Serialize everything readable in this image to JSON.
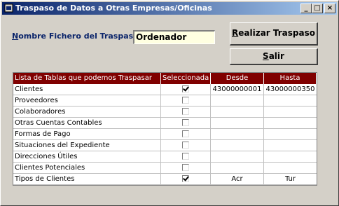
{
  "window": {
    "title": "Traspaso de Datos a Otras Empresas/Oficinas",
    "minimize": "_",
    "maximize": "□",
    "close": "×"
  },
  "form": {
    "fichero_label_first": "N",
    "fichero_label_rest": "ombre Fichero del Traspaso",
    "fichero_value": "Ordenador"
  },
  "buttons": {
    "realizar_first": "R",
    "realizar_rest": "ealizar Traspaso",
    "salir_first": "S",
    "salir_rest": "alir"
  },
  "table": {
    "headers": [
      "Lista de Tablas que podemos Traspasar",
      "Seleccionada",
      "Desde",
      "Hasta"
    ],
    "rows": [
      {
        "name": "Clientes",
        "checked": true,
        "desde": "43000000001",
        "hasta": "43000000350"
      },
      {
        "name": "Proveedores",
        "checked": false,
        "desde": "",
        "hasta": ""
      },
      {
        "name": "Colaboradores",
        "checked": false,
        "desde": "",
        "hasta": ""
      },
      {
        "name": "Otras Cuentas Contables",
        "checked": false,
        "desde": "",
        "hasta": ""
      },
      {
        "name": "Formas de Pago",
        "checked": false,
        "desde": "",
        "hasta": ""
      },
      {
        "name": "Situaciones del Expediente",
        "checked": false,
        "desde": "",
        "hasta": ""
      },
      {
        "name": "Direcciones Útiles",
        "checked": false,
        "desde": "",
        "hasta": ""
      },
      {
        "name": "Clientes Potenciales",
        "checked": false,
        "desde": "",
        "hasta": ""
      },
      {
        "name": "Tipos de Clientes",
        "checked": true,
        "desde": "Acr",
        "hasta": "Tur"
      }
    ]
  }
}
